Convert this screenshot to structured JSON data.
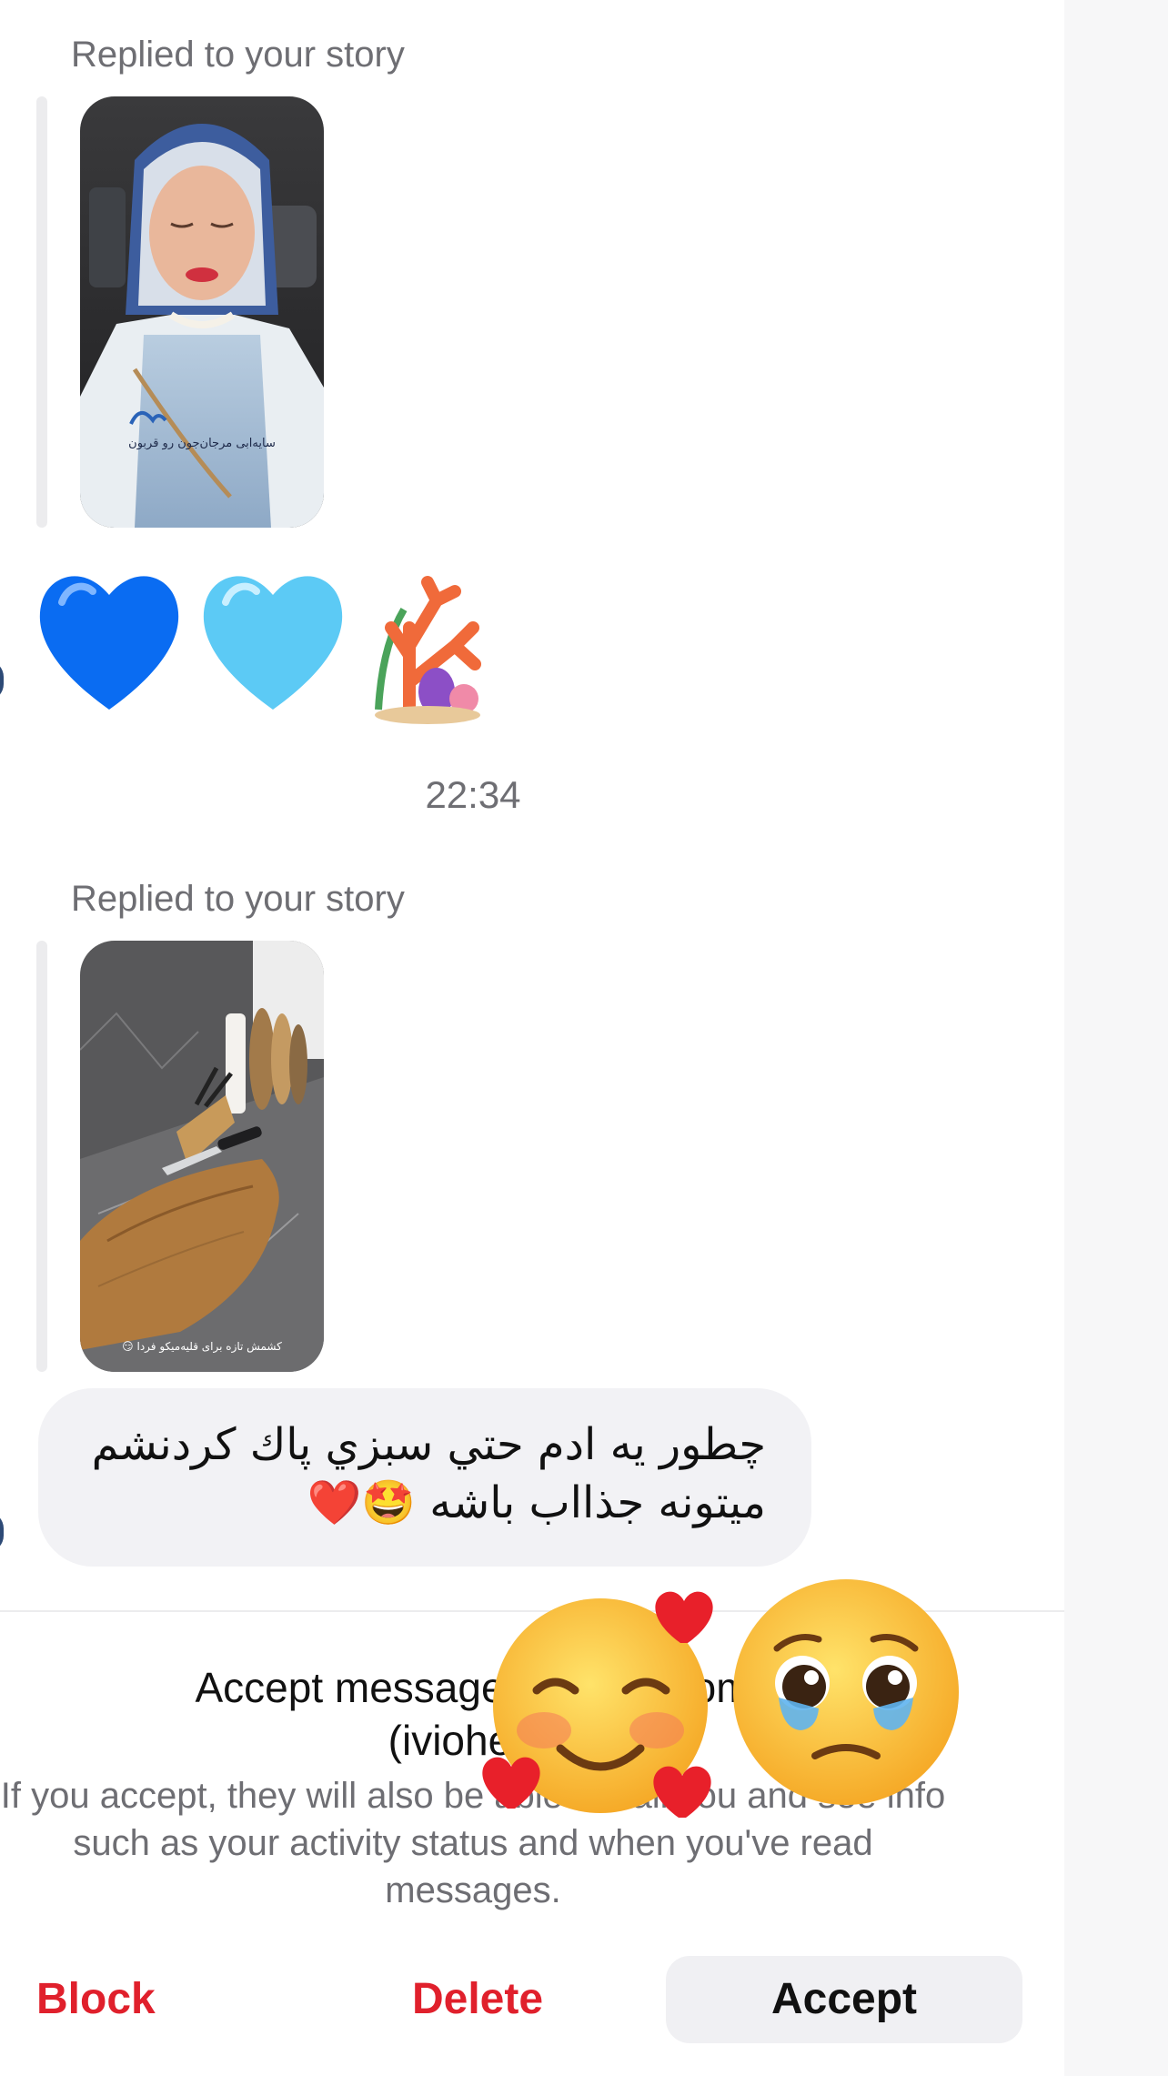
{
  "thread": {
    "messages": [
      {
        "replied_label": "Replied to your story",
        "story_caption": "سایه‌ابی مرجان‌جون رو قربون",
        "reply_emojis": [
          "blue-heart",
          "light-blue-heart",
          "coral"
        ]
      },
      {
        "replied_label": "Replied to your story",
        "story_caption": "کشمش تازه برای قلیه‌میکو فردا 😏",
        "text_line1": "چطور يه ادم حتي سبزي پاك كردنشم",
        "text_line2": "ميتونه جذااب باشه 🤩❤️"
      }
    ],
    "timestamp": "22:34"
  },
  "request": {
    "title_line1": "Accept message request from",
    "title_line2": "(iviohebi)",
    "description": "If you accept, they will also be able to call you and see info such as your activity status and when you've read messages.",
    "buttons": {
      "block": "Block",
      "delete": "Delete",
      "accept": "Accept"
    }
  },
  "reaction_overlay": {
    "emojis": [
      "smiling-face-with-hearts",
      "pleading-face"
    ]
  },
  "colors": {
    "destructive": "#e0202c",
    "secondary_text": "#6e6e73",
    "bubble_bg": "#f2f2f5"
  }
}
